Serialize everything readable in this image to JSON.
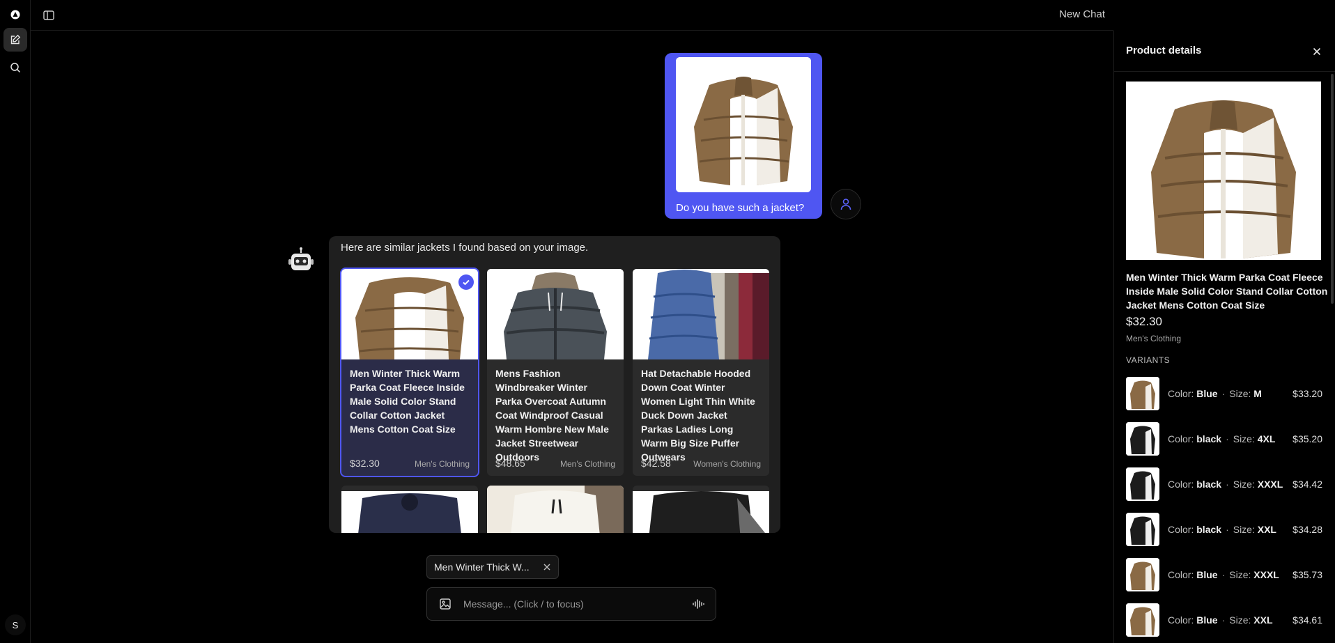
{
  "header": {
    "title": "New Chat"
  },
  "user_message": {
    "text": "Do you have such a jacket?"
  },
  "bot_message": {
    "text": "Here are similar jackets I found based on your image.",
    "products": [
      {
        "title": "Men Winter Thick Warm Parka Coat Fleece Inside Male Solid Color Stand Collar Cotton Jacket Mens Cotton Coat Size",
        "price": "$32.30",
        "category": "Men's Clothing",
        "selected": true
      },
      {
        "title": "Mens Fashion Windbreaker Winter Parka Overcoat Autumn Coat Windproof Casual Warm Hombre New Male Jacket Streetwear Outdoors",
        "price": "$48.65",
        "category": "Men's Clothing",
        "selected": false
      },
      {
        "title": "Hat Detachable Hooded Down Coat Winter Women Light Thin White Duck Down Jacket Parkas Ladies Long Warm Big Size Puffer Outwears",
        "price": "$42.58",
        "category": "Women's Clothing",
        "selected": false
      }
    ]
  },
  "composer": {
    "chip_label": "Men Winter Thick W...",
    "placeholder": "Message... (Click / to focus)"
  },
  "sidebar": {
    "avatar_initial": "S"
  },
  "panel": {
    "heading": "Product details",
    "title": "Men Winter Thick Warm Parka Coat Fleece Inside Male Solid Color Stand Collar Cotton Jacket Mens Cotton Coat Size",
    "price": "$32.30",
    "category": "Men's Clothing",
    "variants_label": "VARIANTS",
    "color_label": "Color:",
    "size_label": "Size:",
    "variants": [
      {
        "color": "Blue",
        "size": "M",
        "price": "$33.20"
      },
      {
        "color": "black",
        "size": "4XL",
        "price": "$35.20"
      },
      {
        "color": "black",
        "size": "XXXL",
        "price": "$34.42"
      },
      {
        "color": "black",
        "size": "XXL",
        "price": "$34.28"
      },
      {
        "color": "Blue",
        "size": "XXXL",
        "price": "$35.73"
      },
      {
        "color": "Blue",
        "size": "XXL",
        "price": "$34.61"
      }
    ]
  },
  "colors": {
    "accent": "#4f56f2",
    "background": "#000000",
    "card": "#2b2b2b",
    "bubble": "#1f1f1f"
  },
  "icons": [
    "logo-icon",
    "new-chat-icon",
    "search-icon",
    "sidebar-toggle-icon",
    "user-icon",
    "bot-icon",
    "check-icon",
    "close-icon",
    "image-icon",
    "voice-icon"
  ]
}
